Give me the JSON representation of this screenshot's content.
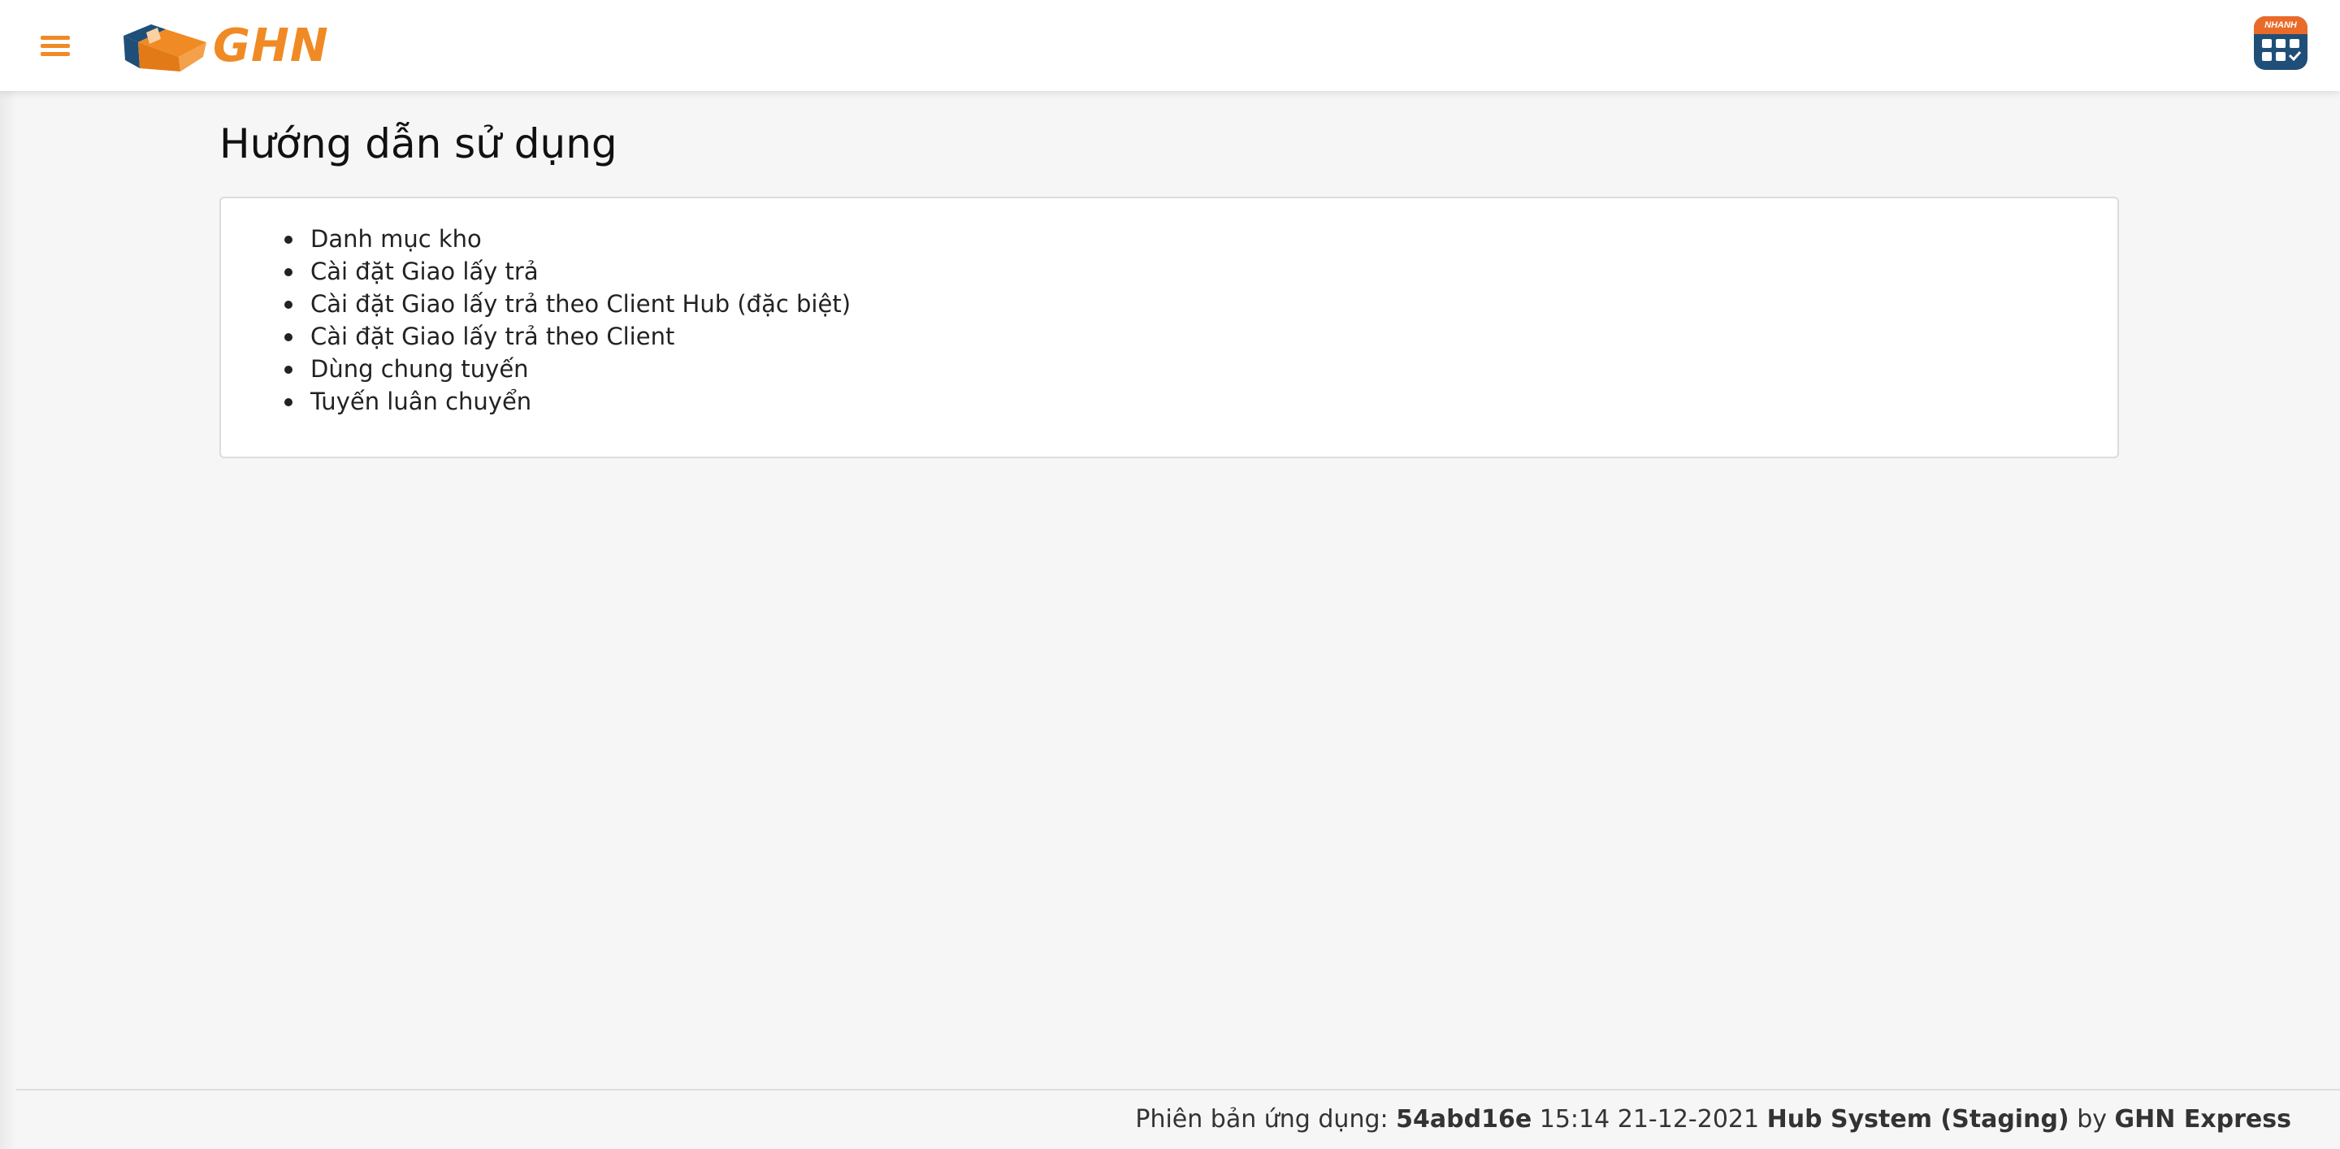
{
  "header": {
    "logo_text": "GHN",
    "apps_badge_text": "NHANH",
    "accent_color": "#f08a24"
  },
  "page": {
    "title": "Hướng dẫn sử dụng"
  },
  "guide": {
    "items": [
      "Danh mục kho",
      "Cài đặt Giao lấy trả",
      "Cài đặt Giao lấy trả theo Client Hub (đặc biệt)",
      "Cài đặt Giao lấy trả theo Client",
      "Dùng chung tuyến",
      "Tuyến luân chuyển"
    ]
  },
  "footer": {
    "version_label": "Phiên bản ứng dụng:",
    "commit": "54abd16e",
    "datetime": "15:14 21-12-2021",
    "system": "Hub System (Staging)",
    "by": "by",
    "company": "GHN Express"
  }
}
